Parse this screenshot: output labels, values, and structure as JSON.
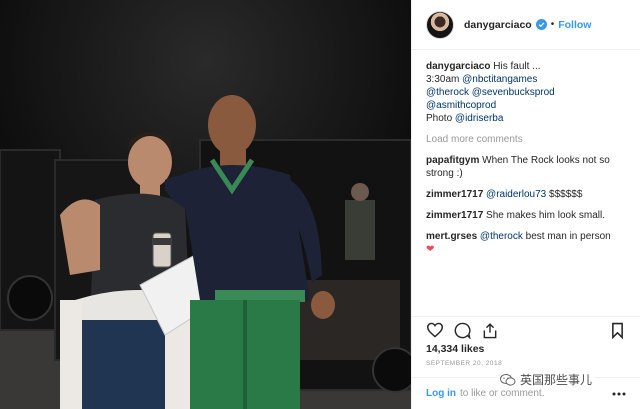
{
  "post": {
    "username": "danygarciaco",
    "follow_label": "Follow",
    "caption": {
      "username": "danygarciaco",
      "line1_text": "His fault ...",
      "line2_prefix": "3:30am",
      "mention_nbc": "@nbctitangames",
      "mention_therock": "@therock",
      "mention_sevenbucks": "@sevenbucksprod",
      "mention_asmith": "@asmithcoprod",
      "photo_prefix": "Photo",
      "mention_idriserba": "@idriserba"
    },
    "load_more": "Load more comments",
    "comments": [
      {
        "username": "papafitgym",
        "text": "When The Rock looks not so strong :)"
      },
      {
        "username": "zimmer1717",
        "mention": "@raiderlou73",
        "text": "$$$$$$"
      },
      {
        "username": "zimmer1717",
        "text": "She makes him look small."
      },
      {
        "username": "mert.grses",
        "mention": "@therock",
        "text": "best man in person",
        "emoji": "❤"
      }
    ],
    "likes": "14,334 likes",
    "date": "SEPTEMBER 20, 2018"
  },
  "footer": {
    "login_label": "Log in",
    "rest": "to like or comment."
  },
  "watermark": {
    "text": "英国那些事儿"
  },
  "icons": {
    "verified": "verified-badge-icon",
    "like": "heart-outline-icon",
    "comment": "comment-bubble-icon",
    "share": "share-icon",
    "save": "bookmark-icon",
    "more": "more-dots-icon"
  },
  "colors": {
    "link": "#003569",
    "accent": "#3897f0",
    "muted": "#999999",
    "heart": "#ed4956"
  }
}
